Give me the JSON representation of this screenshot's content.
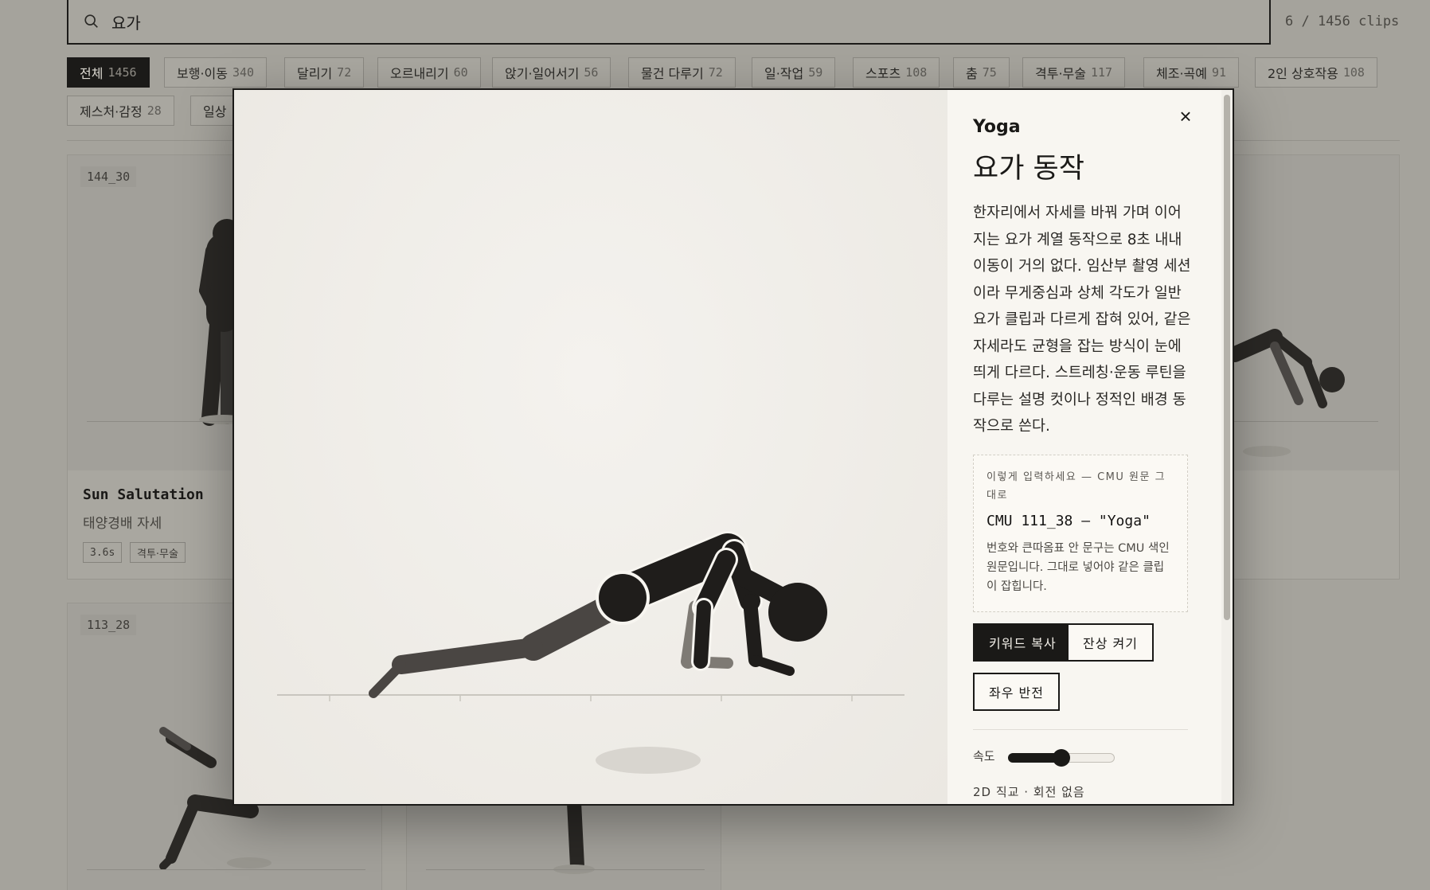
{
  "search": {
    "value": "요가",
    "placeholder": ""
  },
  "clip_count": "6 / 1456 clips",
  "chips": [
    {
      "label": "전체",
      "count": "1456"
    },
    {
      "label": "보행·이동",
      "count": "340"
    },
    {
      "label": "달리기",
      "count": "72"
    },
    {
      "label": "오르내리기",
      "count": "60"
    },
    {
      "label": "앉기·일어서기",
      "count": "56"
    },
    {
      "label": "물건 다루기",
      "count": "72"
    },
    {
      "label": "일·작업",
      "count": "59"
    },
    {
      "label": "스포츠",
      "count": "108"
    },
    {
      "label": "춤",
      "count": "75"
    },
    {
      "label": "격투·무술",
      "count": "117"
    },
    {
      "label": "체조·곡예",
      "count": "91"
    },
    {
      "label": "2인 상호작용",
      "count": "108"
    },
    {
      "label": "제스처·감정",
      "count": "28"
    },
    {
      "label": "일상",
      "count": ""
    }
  ],
  "cards": [
    {
      "id": "144_30",
      "title": "Sun Salutation",
      "subtitle": "태양경배 자세",
      "tags": [
        "3.6s",
        "격투·무술"
      ]
    },
    {
      "id": "113_28"
    }
  ],
  "modal": {
    "close": "×",
    "title_en": "Yoga",
    "title_ko": "요가 동작",
    "description": "한자리에서 자세를 바꿔 가며 이어지는 요가 계열 동작으로 8초 내내 이동이 거의 없다. 임산부 촬영 세션이라 무게중심과 상체 각도가 일반 요가 클립과 다르게 잡혀 있어, 같은 자세라도 균형을 잡는 방식이 눈에 띄게 다르다. 스트레칭·운동 루틴을 다루는 설명 컷이나 정적인 배경 동작으로 쓴다.",
    "hint_label": "이렇게 입력하세요 — CMU 원문 그대로",
    "hint_code": "CMU 111_38 — \"Yoga\"",
    "hint_note": "번호와 큰따옴표 안 문구는 CMU 색인 원문입니다. 그대로 넣어야 같은 클립이 잡힙니다.",
    "buttons": {
      "copy": "키워드 복사",
      "trail": "잔상 켜기",
      "mirror": "좌우 반전"
    },
    "speed_label": "속도",
    "speed_value": 0.5,
    "meta": "2D 직교 · 회전 없음"
  },
  "colors": {
    "ink": "#1a1917",
    "bg_overlay": "#a5a39c",
    "stage": "#f1efea"
  }
}
